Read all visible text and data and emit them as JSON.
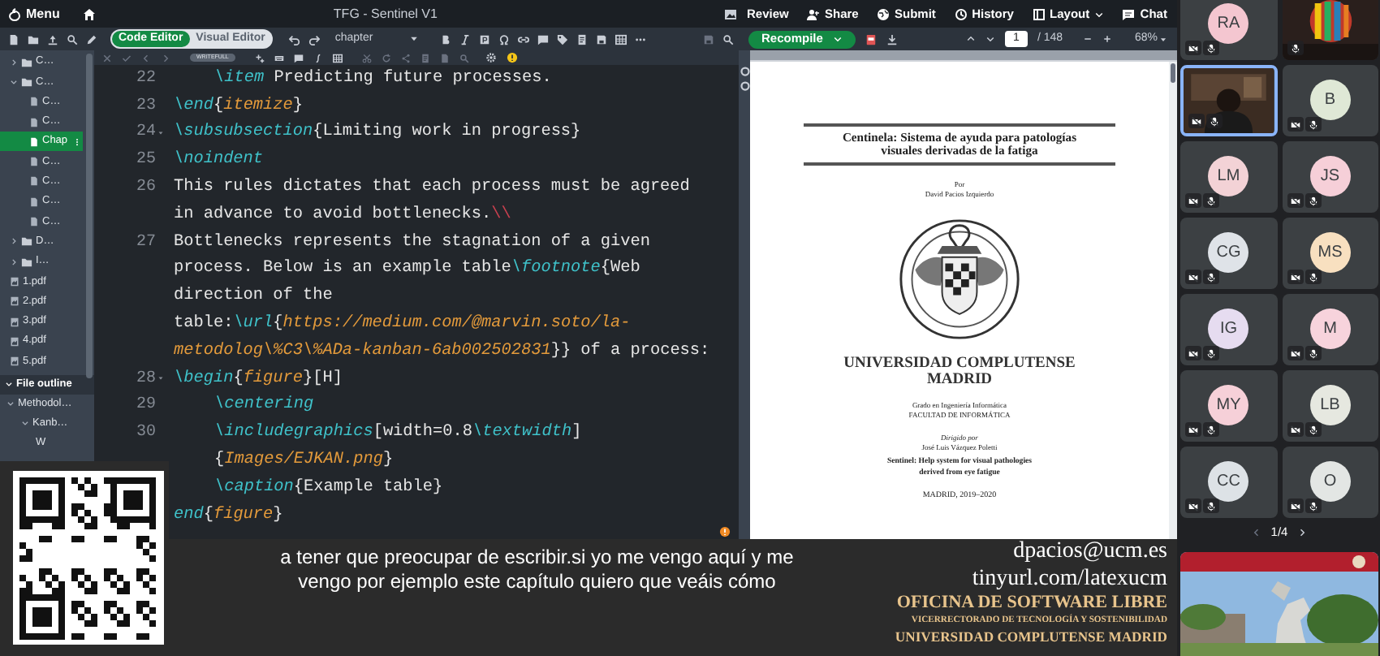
{
  "top_bar": {
    "menu": "Menu",
    "title": "TFG - Sentinel V1",
    "actions": [
      {
        "label": "Review"
      },
      {
        "label": "Share"
      },
      {
        "label": "Submit"
      },
      {
        "label": "History"
      },
      {
        "label": "Layout"
      },
      {
        "label": "Chat"
      }
    ]
  },
  "editor_toolbar": {
    "modes": [
      {
        "label": "Code Editor",
        "selected": true
      },
      {
        "label": "Visual Editor",
        "selected": false
      }
    ],
    "style_dropdown": "chapter",
    "badge": "WRITEFULL"
  },
  "pdf_toolbar": {
    "recompile": "Recompile",
    "page": "1",
    "page_count": "/ 148",
    "zoom": "68%"
  },
  "file_tree": [
    {
      "kind": "folder",
      "label": "C…",
      "expanded": false,
      "selected": false
    },
    {
      "kind": "folder",
      "label": "C…",
      "expanded": true,
      "selected": false,
      "children": [
        {
          "kind": "file",
          "label": "C…",
          "selected": false
        },
        {
          "kind": "file",
          "label": "C…",
          "selected": false
        },
        {
          "kind": "file",
          "label": "Chap",
          "selected": true
        },
        {
          "kind": "file",
          "label": "C…",
          "selected": false
        },
        {
          "kind": "file",
          "label": "C…",
          "selected": false
        },
        {
          "kind": "file",
          "label": "C…",
          "selected": false
        },
        {
          "kind": "file",
          "label": "C…",
          "selected": false
        }
      ]
    },
    {
      "kind": "folder",
      "label": "D…",
      "expanded": false,
      "selected": false
    },
    {
      "kind": "folder",
      "label": "I…",
      "expanded": false,
      "selected": false
    },
    {
      "kind": "pdf",
      "label": "1.pdf",
      "selected": false
    },
    {
      "kind": "pdf",
      "label": "2.pdf",
      "selected": false
    },
    {
      "kind": "pdf",
      "label": "3.pdf",
      "selected": false
    },
    {
      "kind": "pdf",
      "label": "4.pdf",
      "selected": false
    },
    {
      "kind": "pdf",
      "label": "5.pdf",
      "selected": false
    }
  ],
  "file_outline": {
    "title": "File outline",
    "items": [
      {
        "label": "Methodol…",
        "expanded": true,
        "children": [
          {
            "label": "Kanb…",
            "expanded": true,
            "children": [
              {
                "label": "W"
              }
            ]
          }
        ]
      }
    ]
  },
  "code_lines": [
    {
      "number": "22",
      "fold": false,
      "indent": true,
      "segments": [
        {
          "kind": "cmd",
          "text": "\\item"
        },
        {
          "kind": "text",
          "text": " Predicting future processes."
        }
      ]
    },
    {
      "number": "23",
      "fold": false,
      "indent": false,
      "segments": [
        {
          "kind": "cmd",
          "text": "\\end"
        },
        {
          "kind": "text",
          "text": "{"
        },
        {
          "kind": "arg",
          "text": "itemize"
        },
        {
          "kind": "text",
          "text": "}"
        }
      ]
    },
    {
      "number": "24",
      "fold": true,
      "indent": false,
      "segments": [
        {
          "kind": "cmd",
          "text": "\\subsubsection"
        },
        {
          "kind": "text",
          "text": "{Limiting work in progress}"
        }
      ]
    },
    {
      "number": "25",
      "fold": false,
      "indent": false,
      "segments": [
        {
          "kind": "cmd",
          "text": "\\noindent"
        }
      ]
    },
    {
      "number": "26",
      "fold": false,
      "indent": false,
      "segments": [
        {
          "kind": "text",
          "text": "This rules dictates that each process must be agreed"
        }
      ]
    },
    {
      "indent": false,
      "segments": [
        {
          "kind": "text",
          "text": "in advance to avoid bottlenecks."
        },
        {
          "kind": "break",
          "text": "\\\\"
        }
      ]
    },
    {
      "number": "27",
      "fold": false,
      "indent": false,
      "segments": [
        {
          "kind": "text",
          "text": "Bottlenecks represents the stagnation of a given"
        }
      ]
    },
    {
      "indent": false,
      "segments": [
        {
          "kind": "text",
          "text": "process. Below is an example table"
        },
        {
          "kind": "cmd",
          "text": "\\footnote"
        },
        {
          "kind": "text",
          "text": "{Web"
        }
      ]
    },
    {
      "indent": false,
      "segments": [
        {
          "kind": "text",
          "text": "direction of the"
        }
      ]
    },
    {
      "indent": false,
      "segments": [
        {
          "kind": "text",
          "text": "table:"
        },
        {
          "kind": "cmd",
          "text": "\\url"
        },
        {
          "kind": "text",
          "text": "{"
        },
        {
          "kind": "arg",
          "text": "https://medium.com/@marvin.soto/la-"
        }
      ]
    },
    {
      "indent": false,
      "segments": [
        {
          "kind": "arg",
          "text": "metodolog\\%C3\\%ADa-kanban-6ab002502831"
        },
        {
          "kind": "text",
          "text": "}} of a process:"
        }
      ]
    },
    {
      "number": "28",
      "fold": true,
      "indent": false,
      "segments": [
        {
          "kind": "cmd",
          "text": "\\begin"
        },
        {
          "kind": "text",
          "text": "{"
        },
        {
          "kind": "arg",
          "text": "figure"
        },
        {
          "kind": "text",
          "text": "}[H]"
        }
      ]
    },
    {
      "number": "29",
      "fold": false,
      "indent": true,
      "segments": [
        {
          "kind": "cmd",
          "text": "\\centering"
        }
      ]
    },
    {
      "number": "30",
      "fold": false,
      "indent": true,
      "segments": [
        {
          "kind": "cmd",
          "text": "\\includegraphics"
        },
        {
          "kind": "text",
          "text": "[width=0.8"
        },
        {
          "kind": "cmd",
          "text": "\\textwidth"
        },
        {
          "kind": "text",
          "text": "]"
        }
      ]
    },
    {
      "indent": true,
      "segments": [
        {
          "kind": "text",
          "text": "{"
        },
        {
          "kind": "arg",
          "text": "Images/EJKAN.png"
        },
        {
          "kind": "text",
          "text": "}"
        }
      ]
    },
    {
      "indent": true,
      "segments": [
        {
          "kind": "cmd",
          "text": "\\caption"
        },
        {
          "kind": "text",
          "text": "{Example table}"
        }
      ]
    },
    {
      "indent": false,
      "segments": [
        {
          "kind": "cmd",
          "text": "end"
        },
        {
          "kind": "text",
          "text": "{"
        },
        {
          "kind": "arg",
          "text": "figure"
        },
        {
          "kind": "text",
          "text": "}"
        }
      ]
    }
  ],
  "pdf_page": {
    "title_lines": [
      "Centinela: Sistema de ayuda para patologías",
      "visuales derivadas de la fatiga"
    ],
    "by": "Por",
    "author": "David Pacios Izquierdo",
    "university_lines": [
      "UNIVERSIDAD COMPLUTENSE",
      "MADRID"
    ],
    "degree": "Grado en Ingeniería Informática",
    "faculty": "FACULTAD DE INFORMÁTICA",
    "directed_by": "Dirigido por",
    "director": "José Luis Vázquez Poletti",
    "english_title_lines": [
      "Sentinel: Help system for visual pathologies",
      "derived from eye fatigue"
    ],
    "date": "MADRID, 2019–2020"
  },
  "subtitles": [
    "a tener que preocupar de escribir.si yo me vengo aquí y me",
    "vengo por ejemplo este capítulo quiero que veáis cómo"
  ],
  "contact": {
    "email": "dpacios@ucm.es",
    "url": "tinyurl.com/latexucm",
    "office": "OFICINA DE SOFTWARE LIBRE",
    "vicerrectorado": "VICERRECTORADO DE TECNOLOGÍA Y SOSTENIBILIDAD",
    "university": "UNIVERSIDAD COMPLUTENSE MADRID"
  },
  "participants": [
    {
      "kind": "avatar",
      "initials": "RA",
      "color": "#f4c6d0",
      "camera_muted": true,
      "speaking": false
    },
    {
      "kind": "video",
      "camera_muted": false,
      "speaking": false
    },
    {
      "kind": "video",
      "camera_muted": true,
      "speaking": true
    },
    {
      "kind": "avatar",
      "initials": "B",
      "color": "#dfe8d6",
      "camera_muted": true,
      "speaking": false
    },
    {
      "kind": "avatar",
      "initials": "LM",
      "color": "#f3d2d6",
      "camera_muted": true,
      "speaking": false
    },
    {
      "kind": "avatar",
      "initials": "JS",
      "color": "#f6cfd8",
      "camera_muted": true,
      "speaking": false
    },
    {
      "kind": "avatar",
      "initials": "CG",
      "color": "#dfe3e8",
      "camera_muted": true,
      "speaking": false
    },
    {
      "kind": "avatar",
      "initials": "MS",
      "color": "#f8e0c0",
      "camera_muted": true,
      "speaking": false
    },
    {
      "kind": "avatar",
      "initials": "IG",
      "color": "#e6dcf0",
      "camera_muted": true,
      "speaking": false
    },
    {
      "kind": "avatar",
      "initials": "M",
      "color": "#f7d3dc",
      "camera_muted": true,
      "speaking": false
    },
    {
      "kind": "avatar",
      "initials": "MY",
      "color": "#f6d0d8",
      "camera_muted": true,
      "speaking": false
    },
    {
      "kind": "avatar",
      "initials": "LB",
      "color": "#e6e8e0",
      "camera_muted": true,
      "speaking": false
    },
    {
      "kind": "avatar",
      "initials": "CC",
      "color": "#dde2e6",
      "camera_muted": true,
      "speaking": false
    },
    {
      "kind": "avatar",
      "initials": "O",
      "color": "#e3e6e4",
      "camera_muted": true,
      "speaking": false
    }
  ],
  "pager": "1/4"
}
